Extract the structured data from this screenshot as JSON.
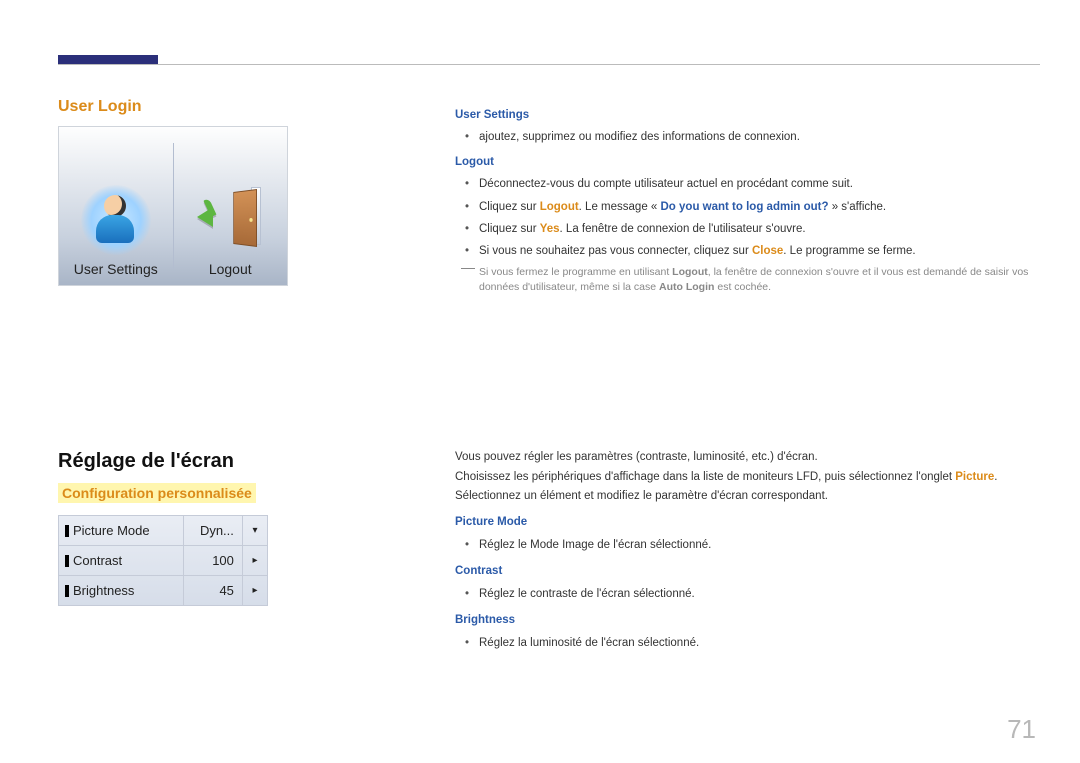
{
  "page_number": "71",
  "section1": {
    "title": "User Login",
    "items": [
      {
        "label": "User Settings"
      },
      {
        "label": "Logout"
      }
    ]
  },
  "right1": {
    "user_settings": {
      "heading": "User Settings",
      "b1": "ajoutez, supprimez ou modifiez des informations de connexion."
    },
    "logout": {
      "heading": "Logout",
      "b1": "Déconnectez-vous du compte utilisateur actuel en procédant comme suit.",
      "b2_pre": "Cliquez sur ",
      "b2_logout": "Logout",
      "b2_mid": ". Le message « ",
      "b2_msg": "Do you want to log admin out?",
      "b2_post": " » s'affiche.",
      "b3_pre": "Cliquez sur ",
      "b3_yes": "Yes",
      "b3_post": ". La fenêtre de connexion de l'utilisateur s'ouvre.",
      "b4_pre": "Si vous ne souhaitez pas vous connecter, cliquez sur ",
      "b4_close": "Close",
      "b4_post": ". Le programme se ferme.",
      "note_pre": "Si vous fermez le programme en utilisant ",
      "note_logout": "Logout",
      "note_mid": ", la fenêtre de connexion s'ouvre et il vous est demandé de saisir vos données d'utilisateur, même si la case ",
      "note_auto": "Auto Login",
      "note_post": " est cochée."
    }
  },
  "section2": {
    "heading": "Réglage de l'écran",
    "subheading": "Configuration personnalisée",
    "rows": [
      {
        "label": "Picture Mode",
        "value": "Dyn...",
        "control": "▾"
      },
      {
        "label": "Contrast",
        "value": "100",
        "control": "▸"
      },
      {
        "label": "Brightness",
        "value": "45",
        "control": "▸"
      }
    ]
  },
  "right2": {
    "p1": "Vous pouvez régler les paramètres (contraste, luminosité, etc.) d'écran.",
    "p2_pre": "Choisissez les périphériques d'affichage dans la liste de moniteurs LFD, puis sélectionnez l'onglet ",
    "p2_pic": "Picture",
    "p2_post": ".",
    "p3": "Sélectionnez un élément et modifiez le paramètre d'écran correspondant.",
    "picture_mode": {
      "heading": "Picture Mode",
      "b1": "Réglez le Mode Image de l'écran sélectionné."
    },
    "contrast": {
      "heading": "Contrast",
      "b1": "Réglez le contraste de l'écran sélectionné."
    },
    "brightness": {
      "heading": "Brightness",
      "b1": "Réglez la luminosité de l'écran sélectionné."
    }
  }
}
